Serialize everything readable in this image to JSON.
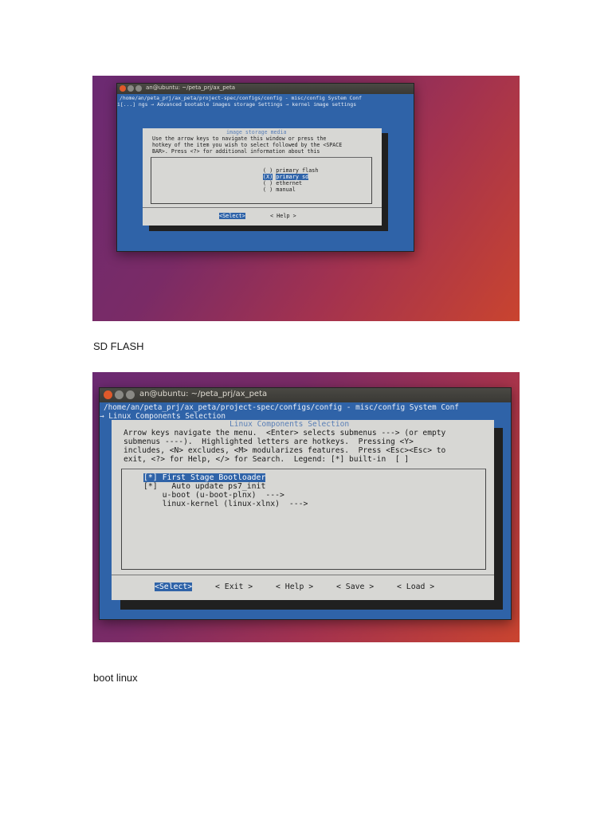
{
  "shot1": {
    "window_title": "an@ubuntu: ~/peta_prj/ax_peta",
    "path_line": "/home/an/peta_prj/ax_peta/project-spec/configs/config - misc/config System Conf",
    "breadcrumb": "i[...] ngs → Advanced bootable images storage Settings → kernel image settings",
    "dialog_title": "image storage media",
    "help_text": [
      "Use the arrow keys to navigate this window or press the",
      "hotkey of the item you wish to select followed by the <SPACE",
      "BAR>. Press <?> for additional information about this"
    ],
    "options": [
      {
        "mark": "( )",
        "label": "primary flash",
        "selected": false
      },
      {
        "mark": "(X)",
        "label": "primary sd",
        "selected": true
      },
      {
        "mark": "( )",
        "label": "ethernet",
        "selected": false
      },
      {
        "mark": "( )",
        "label": "manual",
        "selected": false
      }
    ],
    "buttons": {
      "select": "<Select>",
      "help": "< Help >"
    }
  },
  "caption1": "",
  "caption2": " SD  FLASH",
  "shot2": {
    "window_title": "an@ubuntu: ~/peta_prj/ax_peta",
    "path_line": "/home/an/peta_prj/ax_peta/project-spec/configs/config - misc/config System Conf",
    "breadcrumb": "→ Linux Components Selection",
    "dialog_title": "Linux Components Selection",
    "help_text": [
      "Arrow keys navigate the menu.  <Enter> selects submenus ---> (or empty",
      "submenus ----).  Highlighted letters are hotkeys.  Pressing <Y>",
      "includes, <N> excludes, <M> modularizes features.  Press <Esc><Esc> to",
      "exit, <?> for Help, </> for Search.  Legend: [*] built-in  [ ]"
    ],
    "items": [
      {
        "text": "[*] First Stage Bootloader",
        "selected": true
      },
      {
        "text": "[*]   Auto update ps7_init",
        "selected": false
      },
      {
        "text": "    u-boot (u-boot-plnx)  --->",
        "selected": false
      },
      {
        "text": "    linux-kernel (linux-xlnx)  --->",
        "selected": false
      }
    ],
    "buttons": {
      "select": "<Select>",
      "exit": "< Exit >",
      "help": "< Help >",
      "save": "< Save >",
      "load": "< Load >"
    }
  },
  "caption3": " boot  linux ",
  "caption4": ""
}
